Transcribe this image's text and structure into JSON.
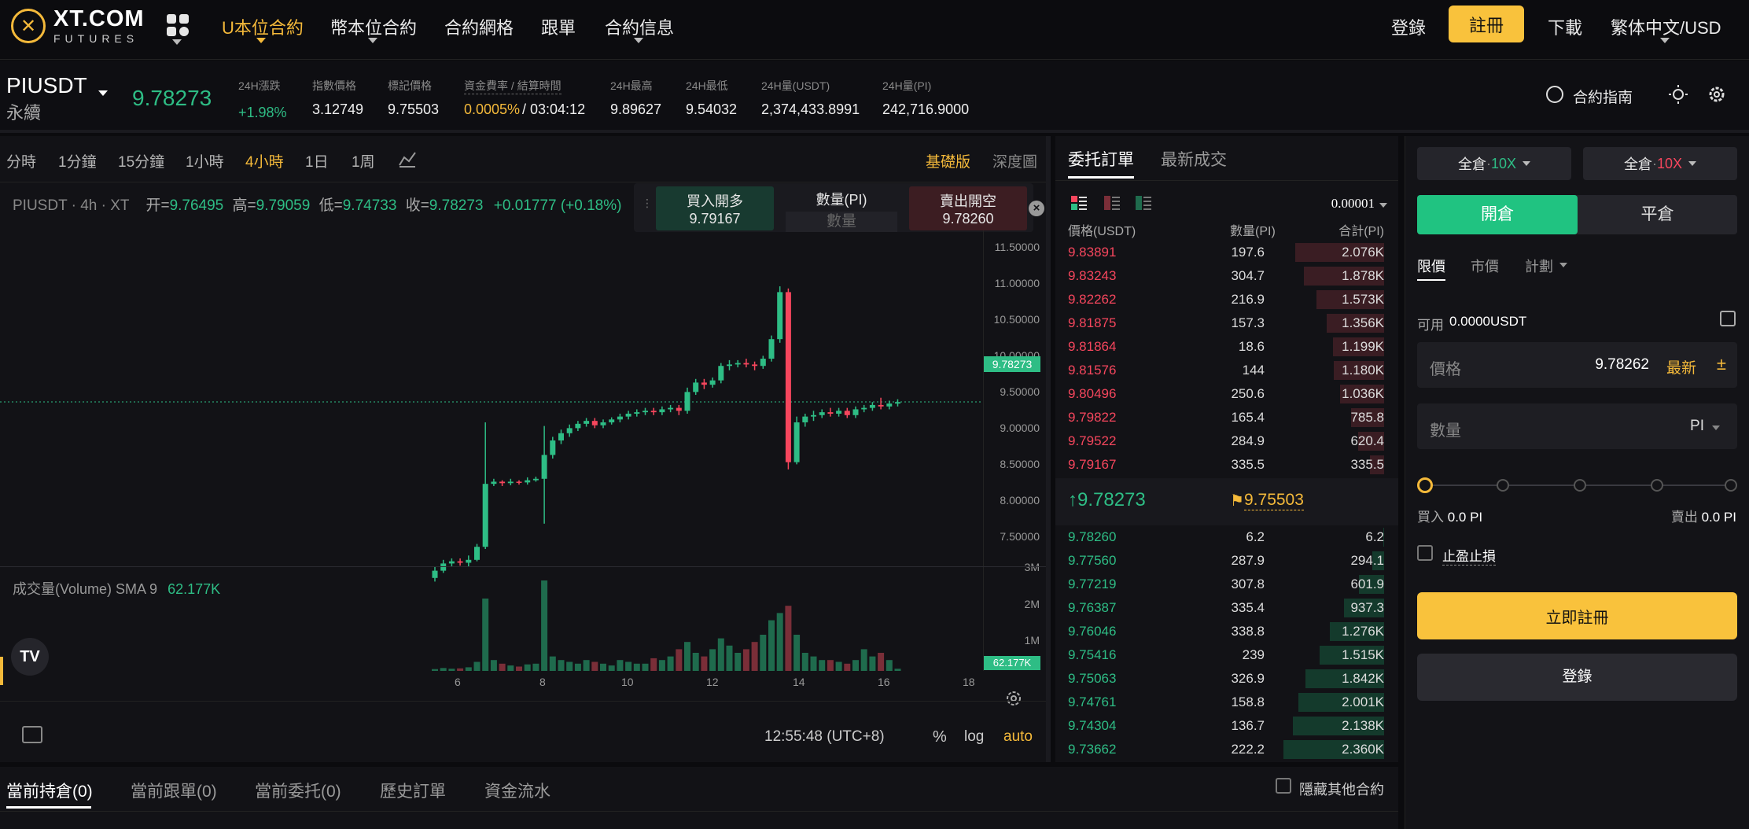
{
  "brand": {
    "name": "XT.COM",
    "sub": "FUTURES"
  },
  "nav": {
    "items": [
      "U本位合約",
      "幣本位合約",
      "合約網格",
      "跟單",
      "合約信息"
    ],
    "login": "登錄",
    "register": "註冊",
    "download": "下載",
    "lang": "繁体中文/USD"
  },
  "ticker": {
    "symbol": "PIUSDT",
    "type": "永續",
    "price": "9.78273",
    "stats": [
      {
        "label": "24H漲跌",
        "value": "+1.98%"
      },
      {
        "label": "指數價格",
        "value": "3.12749"
      },
      {
        "label": "標記價格",
        "value": "9.75503"
      },
      {
        "label": "資金費率 / 結算時間",
        "value": "0.0005%",
        "value2": "03:04:12"
      },
      {
        "label": "24H最高",
        "value": "9.89627"
      },
      {
        "label": "24H最低",
        "value": "9.54032"
      },
      {
        "label": "24H量(USDT)",
        "value": "2,374,433.8991"
      },
      {
        "label": "24H量(PI)",
        "value": "242,716.9000"
      }
    ],
    "guide": "合約指南"
  },
  "chart": {
    "intervals": [
      "分時",
      "1分鐘",
      "15分鐘",
      "1小時",
      "4小時",
      "1日",
      "1周"
    ],
    "active_interval": "4小時",
    "basic": "基礎版",
    "depth": "深度圖",
    "header": {
      "symbol": "PIUSDT · 4h · XT",
      "o_label": "开=",
      "o": "9.76495",
      "h_label": "高=",
      "h": "9.79059",
      "l_label": "低=",
      "l": "9.74733",
      "c_label": "收=",
      "c": "9.78273",
      "chg": "+0.01777 (+0.18%)"
    },
    "quick": {
      "buy_label": "買入開多",
      "buy_price": "9.79167",
      "qty_label": "數量(PI)",
      "qty_placeholder": "數量",
      "sell_label": "賣出開空",
      "sell_price": "9.78260"
    },
    "price_axis": [
      "11.50000",
      "11.00000",
      "10.50000",
      "10.00000",
      "9.50000",
      "9.00000",
      "8.50000",
      "8.00000",
      "7.50000"
    ],
    "last_price_tag": "9.78273",
    "volume_label": "成交量(Volume) SMA 9",
    "volume_value": "62.177K",
    "volume_axis": [
      "3M",
      "2M",
      "1M"
    ],
    "volume_tag": "62.177K",
    "time_axis": [
      "6",
      "8",
      "10",
      "12",
      "14",
      "16",
      "18"
    ],
    "clock": "12:55:48 (UTC+8)",
    "pct": "%",
    "log": "log",
    "auto": "auto"
  },
  "orderbook": {
    "tabs": [
      "委托訂單",
      "最新成交"
    ],
    "precision": "0.00001",
    "headers": [
      "價格(USDT)",
      "數量(PI)",
      "合計(PI)"
    ],
    "asks": [
      {
        "p": "9.83891",
        "q": "197.6",
        "t": "2.076K",
        "d": 0.88
      },
      {
        "p": "9.83243",
        "q": "304.7",
        "t": "1.878K",
        "d": 0.8
      },
      {
        "p": "9.82262",
        "q": "216.9",
        "t": "1.573K",
        "d": 0.67
      },
      {
        "p": "9.81875",
        "q": "157.3",
        "t": "1.356K",
        "d": 0.57
      },
      {
        "p": "9.81864",
        "q": "18.6",
        "t": "1.199K",
        "d": 0.51
      },
      {
        "p": "9.81576",
        "q": "144",
        "t": "1.180K",
        "d": 0.5
      },
      {
        "p": "9.80496",
        "q": "250.6",
        "t": "1.036K",
        "d": 0.44
      },
      {
        "p": "9.79822",
        "q": "165.4",
        "t": "785.8",
        "d": 0.33
      },
      {
        "p": "9.79522",
        "q": "284.9",
        "t": "620.4",
        "d": 0.26
      },
      {
        "p": "9.79167",
        "q": "335.5",
        "t": "335.5",
        "d": 0.14
      }
    ],
    "last": "9.78273",
    "mark": "9.75503",
    "bids": [
      {
        "p": "9.78260",
        "q": "6.2",
        "t": "6.2",
        "d": 0.01
      },
      {
        "p": "9.77560",
        "q": "287.9",
        "t": "294.1",
        "d": 0.12
      },
      {
        "p": "9.77219",
        "q": "307.8",
        "t": "601.9",
        "d": 0.25
      },
      {
        "p": "9.76387",
        "q": "335.4",
        "t": "937.3",
        "d": 0.4
      },
      {
        "p": "9.76046",
        "q": "338.8",
        "t": "1.276K",
        "d": 0.54
      },
      {
        "p": "9.75416",
        "q": "239",
        "t": "1.515K",
        "d": 0.64
      },
      {
        "p": "9.75063",
        "q": "326.9",
        "t": "1.842K",
        "d": 0.78
      },
      {
        "p": "9.74761",
        "q": "158.8",
        "t": "2.001K",
        "d": 0.85
      },
      {
        "p": "9.74304",
        "q": "136.7",
        "t": "2.138K",
        "d": 0.91
      },
      {
        "p": "9.73662",
        "q": "222.2",
        "t": "2.360K",
        "d": 1.0
      }
    ]
  },
  "trade": {
    "margin_left": "全倉",
    "lev_left": "10X",
    "margin_right": "全倉",
    "lev_right": "10X",
    "open": "開倉",
    "close": "平倉",
    "order_types": [
      "限價",
      "市價",
      "計劃"
    ],
    "avail_label": "可用",
    "avail_value": "0.0000USDT",
    "price_label": "價格",
    "price_value": "9.78262",
    "latest": "最新",
    "qty_label": "數量",
    "qty_unit": "PI",
    "buy_label": "買入",
    "buy_value": "0.0 PI",
    "sell_label": "賣出",
    "sell_value": "0.0 PI",
    "tpsl": "止盈止損",
    "register_btn": "立即註冊",
    "login_btn": "登錄"
  },
  "bottom": {
    "tabs": [
      "當前持倉(0)",
      "當前跟單(0)",
      "當前委托(0)",
      "歷史訂單",
      "資金流水"
    ],
    "hide_label": "隱藏其他合約"
  },
  "colors": {
    "accent": "#f4b93a",
    "up": "#2ebd85",
    "down": "#f6465d",
    "register": "#f9c23c",
    "open_btn": "#20c381"
  }
}
